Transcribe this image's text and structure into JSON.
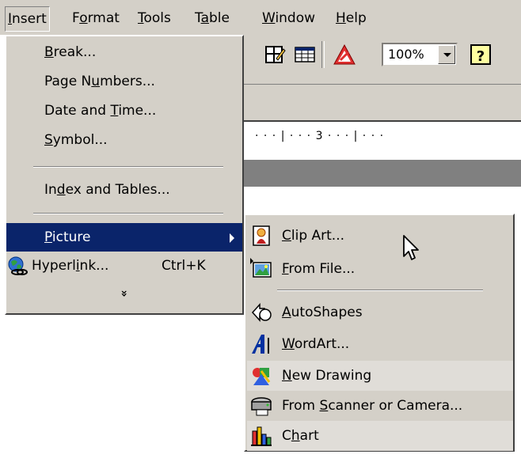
{
  "menubar": {
    "items": [
      {
        "pre": "",
        "ul": "I",
        "post": "nsert"
      },
      {
        "pre": "F",
        "ul": "o",
        "post": "rmat"
      },
      {
        "pre": "",
        "ul": "T",
        "post": "ools"
      },
      {
        "pre": "T",
        "ul": "a",
        "post": "ble"
      },
      {
        "pre": "",
        "ul": "W",
        "post": "indow"
      },
      {
        "pre": "",
        "ul": "H",
        "post": "elp"
      }
    ]
  },
  "toolbar": {
    "zoom_value": "100%"
  },
  "ruler": {
    "text": "· · · | · · · 3 · · · | · · ·"
  },
  "insert_menu": {
    "break": {
      "pre": "",
      "ul": "B",
      "post": "reak..."
    },
    "page_numbers": {
      "pre": "Page N",
      "ul": "u",
      "post": "mbers..."
    },
    "date_time": {
      "pre": "Date and ",
      "ul": "T",
      "post": "ime..."
    },
    "symbol": {
      "pre": "",
      "ul": "S",
      "post": "ymbol..."
    },
    "index_tables": {
      "pre": "In",
      "ul": "d",
      "post": "ex and Tables..."
    },
    "picture": {
      "pre": "",
      "ul": "P",
      "post": "icture"
    },
    "hyperlink": {
      "pre": "Hyperl",
      "ul": "i",
      "post": "nk..."
    },
    "hyperlink_shortcut": "Ctrl+K",
    "expand": "»"
  },
  "picture_menu": {
    "clip_art": {
      "pre": "",
      "ul": "C",
      "post": "lip Art..."
    },
    "from_file": {
      "pre": "",
      "ul": "F",
      "post": "rom File..."
    },
    "autoshapes": {
      "pre": "",
      "ul": "A",
      "post": "utoShapes"
    },
    "wordart": {
      "pre": "",
      "ul": "W",
      "post": "ordArt..."
    },
    "new_drawing": {
      "pre": "",
      "ul": "N",
      "post": "ew Drawing"
    },
    "scanner": {
      "pre": "From ",
      "ul": "S",
      "post": "canner or Camera..."
    },
    "chart": {
      "pre": "C",
      "ul": "h",
      "post": "art"
    }
  },
  "colors": {
    "menu_face": "#d4d0c8",
    "highlight": "#0a246a",
    "shade": "#e0ddd8"
  }
}
